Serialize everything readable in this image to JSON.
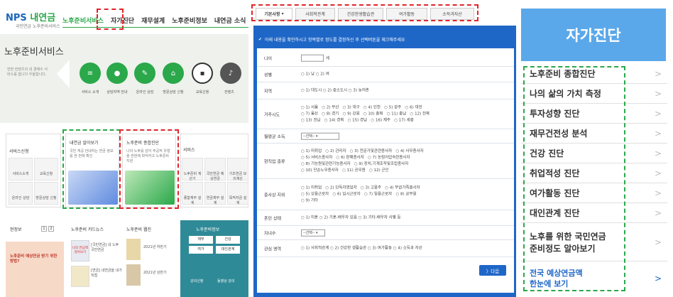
{
  "left": {
    "logo_main": "NPS",
    "logo_kr": "내연금",
    "logo_sub": "국민연금 노후준비서비스",
    "nav": [
      "노후준비서비스",
      "자가진단",
      "재무설계",
      "노후준비정보",
      "내연금 소식"
    ],
    "hero_title": "노후준비서비스",
    "hero_desc": "한번 컨텐츠의 내 경제수 서비스를 합니다 우울합니다.",
    "circles": [
      {
        "label": "서비스 소개",
        "icon": "doc-icon"
      },
      {
        "label": "상담자역 안내",
        "icon": "person-icon"
      },
      {
        "label": "온라인 상담",
        "icon": "chat-icon"
      },
      {
        "label": "방문상담 신청",
        "icon": "building-icon"
      },
      {
        "label": "교육신청",
        "icon": "board-icon"
      },
      {
        "label": "컨텐츠",
        "icon": "mic-icon"
      }
    ],
    "service_title": "서비스신청",
    "service_tiles": [
      "서비스소개",
      "교육신청",
      "온라인 상담",
      "방문상담 신청"
    ],
    "pension_title": "내연금 알아보기",
    "pension_desc": "국민 게공 안내하는 연금 정보를 한 번에 확인",
    "diag_title": "노후준비 종합진단",
    "diag_desc": "나의 노후를 감아 주공적 유형을 한번에 파악하고 노후준비 지원",
    "service2_title": "서비스",
    "service2_tiles": [
      "노후준비 계산기",
      "국민연금 예상연금",
      "기초연금 모의계산",
      "종합재무 설계",
      "연금재무 설계",
      "목적자금 설계"
    ],
    "news_title": "현정보",
    "pagination": [
      "1",
      "2"
    ],
    "cardnews_title": "노후준비 카드뉴스",
    "cardnews_items": [
      "[국민연금] 내 노후 국민연금",
      "[연금] 내연금을 내가 직접"
    ],
    "cardnews_btn1": "나의 연금액 알아보기",
    "cardnews_btn2": "",
    "webzine_title": "노후준비 웹진",
    "webzine_items": [
      "2021년 하반기",
      "2021년 상반기"
    ],
    "promo_title": "노후준비 예상연금 받기 위한 방법?",
    "guide_title": "노후준비정보",
    "guide_tiles": [
      "재무",
      "건강",
      "여가",
      "대인관계",
      "강의신청",
      "동영상 강의"
    ],
    "plus": "+"
  },
  "tabs": [
    "기본사항",
    "사회적관계",
    "건강한생활습관",
    "여가활동",
    "소득과자산"
  ],
  "form": {
    "instruction": "아래 내용을 확인하시고 항목별로 정도를 결정하신 후 선택버튼을 체크해주세요",
    "rows": [
      {
        "label": "나이",
        "value": "세"
      },
      {
        "label": "성별",
        "value": "1) 남   ○ 2) 여"
      },
      {
        "label": "지역",
        "value": "1) 대도시   ○ 2) 중소도시   ○ 3) 농어촌"
      },
      {
        "label": "거주시도",
        "value": "1) 서울   ○ 2) 부산   ○ 3) 대구   ○ 4) 인천   ○ 5) 광주   ○ 6) 대전\n○ 7) 울산   ○ 8) 경기   ○ 9) 강원   ○ 10) 충북   ○ 11) 충남   ○ 12) 전북\n○ 13) 전남   ○ 14) 경북   ○ 15) 경남   ○ 16) 제주   ○ 17) 세종"
      },
      {
        "label": "월평균 소득",
        "value": "--선택--"
      },
      {
        "label": "현직업 종류",
        "value": "1) 미취업   ○ 2) 관리자   ○ 3) 전문가및관련종사자   ○ 4) 사무종사자\n○ 5) 서비스종사자   ○ 6) 판매종사자   ○ 7) 농림어업숙련종사자\n○ 8) 기능원및관련기능종사자   ○ 9) 장치,기계조작및조립종사자\n○ 10) 단순노무종사자   ○ 11) 공무원   ○ 12) 군인"
      },
      {
        "label": "종사상 지위",
        "value": "1) 미취업   ○ 2) 단독자영업자   ○ 3) 고용주   ○ 4) 무급가족종사자\n○ 5) 상용근로자   ○ 6) 임시근로자   ○ 7) 일용근로자   ○ 8) 공무원\n○ 9) 기타"
      },
      {
        "label": "혼인 상태",
        "value": "1) 미혼   ○ 2) 기혼-배우자 있음   ○ 3) 기타-배우자 사별 등"
      },
      {
        "label": "자녀수",
        "value": "--선택--"
      },
      {
        "label": "관심 영역",
        "value": "1) 사회적관계   ○ 2) 건강한 생활습관   ○ 3) 여가활동   ○ 4) 소득과 자산"
      }
    ],
    "next_label": "〉다음"
  },
  "sidebar": {
    "title": "자가진단",
    "items": [
      "노후준비 종합진단",
      "나의 삶의 가치 측정",
      "투자성향 진단",
      "재무건전성 분석",
      "건강 진단",
      "취업적성 진단",
      "여가활동 진단",
      "대인관계 진단",
      "노후를 위한 국민연금\n준비정도 알아보기",
      "전국 예상연금액\n한눈에 보기"
    ],
    "chevron": ">"
  },
  "colors": {
    "primary_blue": "#1f67c7",
    "sidebar_blue": "#5aa8ea",
    "green": "#2aa84a",
    "red_dash": "#e0252b"
  }
}
